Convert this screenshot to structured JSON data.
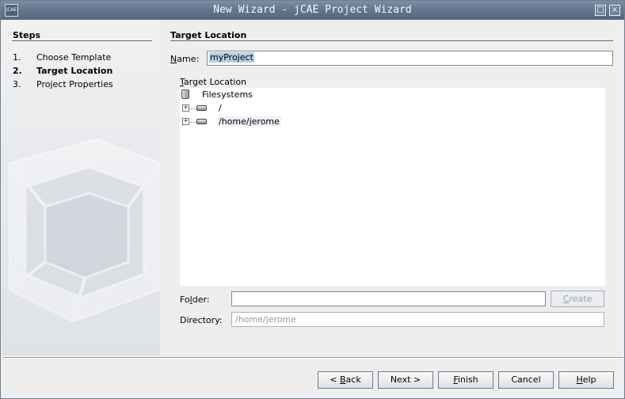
{
  "window": {
    "title": "New Wizard - jCAE Project Wizard",
    "app_icon_text": "jCAE",
    "restore_glyph": "□",
    "close_glyph": "×"
  },
  "steps": {
    "heading": "Steps",
    "items": [
      {
        "num": "1.",
        "label": "Choose Template",
        "active": false
      },
      {
        "num": "2.",
        "label": "Target Location",
        "active": true
      },
      {
        "num": "3.",
        "label": "Project Properties",
        "active": false
      }
    ]
  },
  "panel": {
    "heading": "Target Location",
    "name_label": "Name:",
    "name_value": "myProject",
    "target_location_label": "Target Location",
    "tree": {
      "root": "Filesystems",
      "nodes": [
        "/",
        "/home/jerome"
      ]
    },
    "folder_label": "Folder:",
    "folder_value": "",
    "create_label": "Create",
    "directory_label": "Directory:",
    "directory_value": "/home/jerome"
  },
  "buttons": {
    "back": "< Back",
    "next": "Next >",
    "finish": "Finish",
    "cancel": "Cancel",
    "help": "Help"
  },
  "colors": {
    "titlebar": "#62758d",
    "selection": "#b8cfe5"
  }
}
